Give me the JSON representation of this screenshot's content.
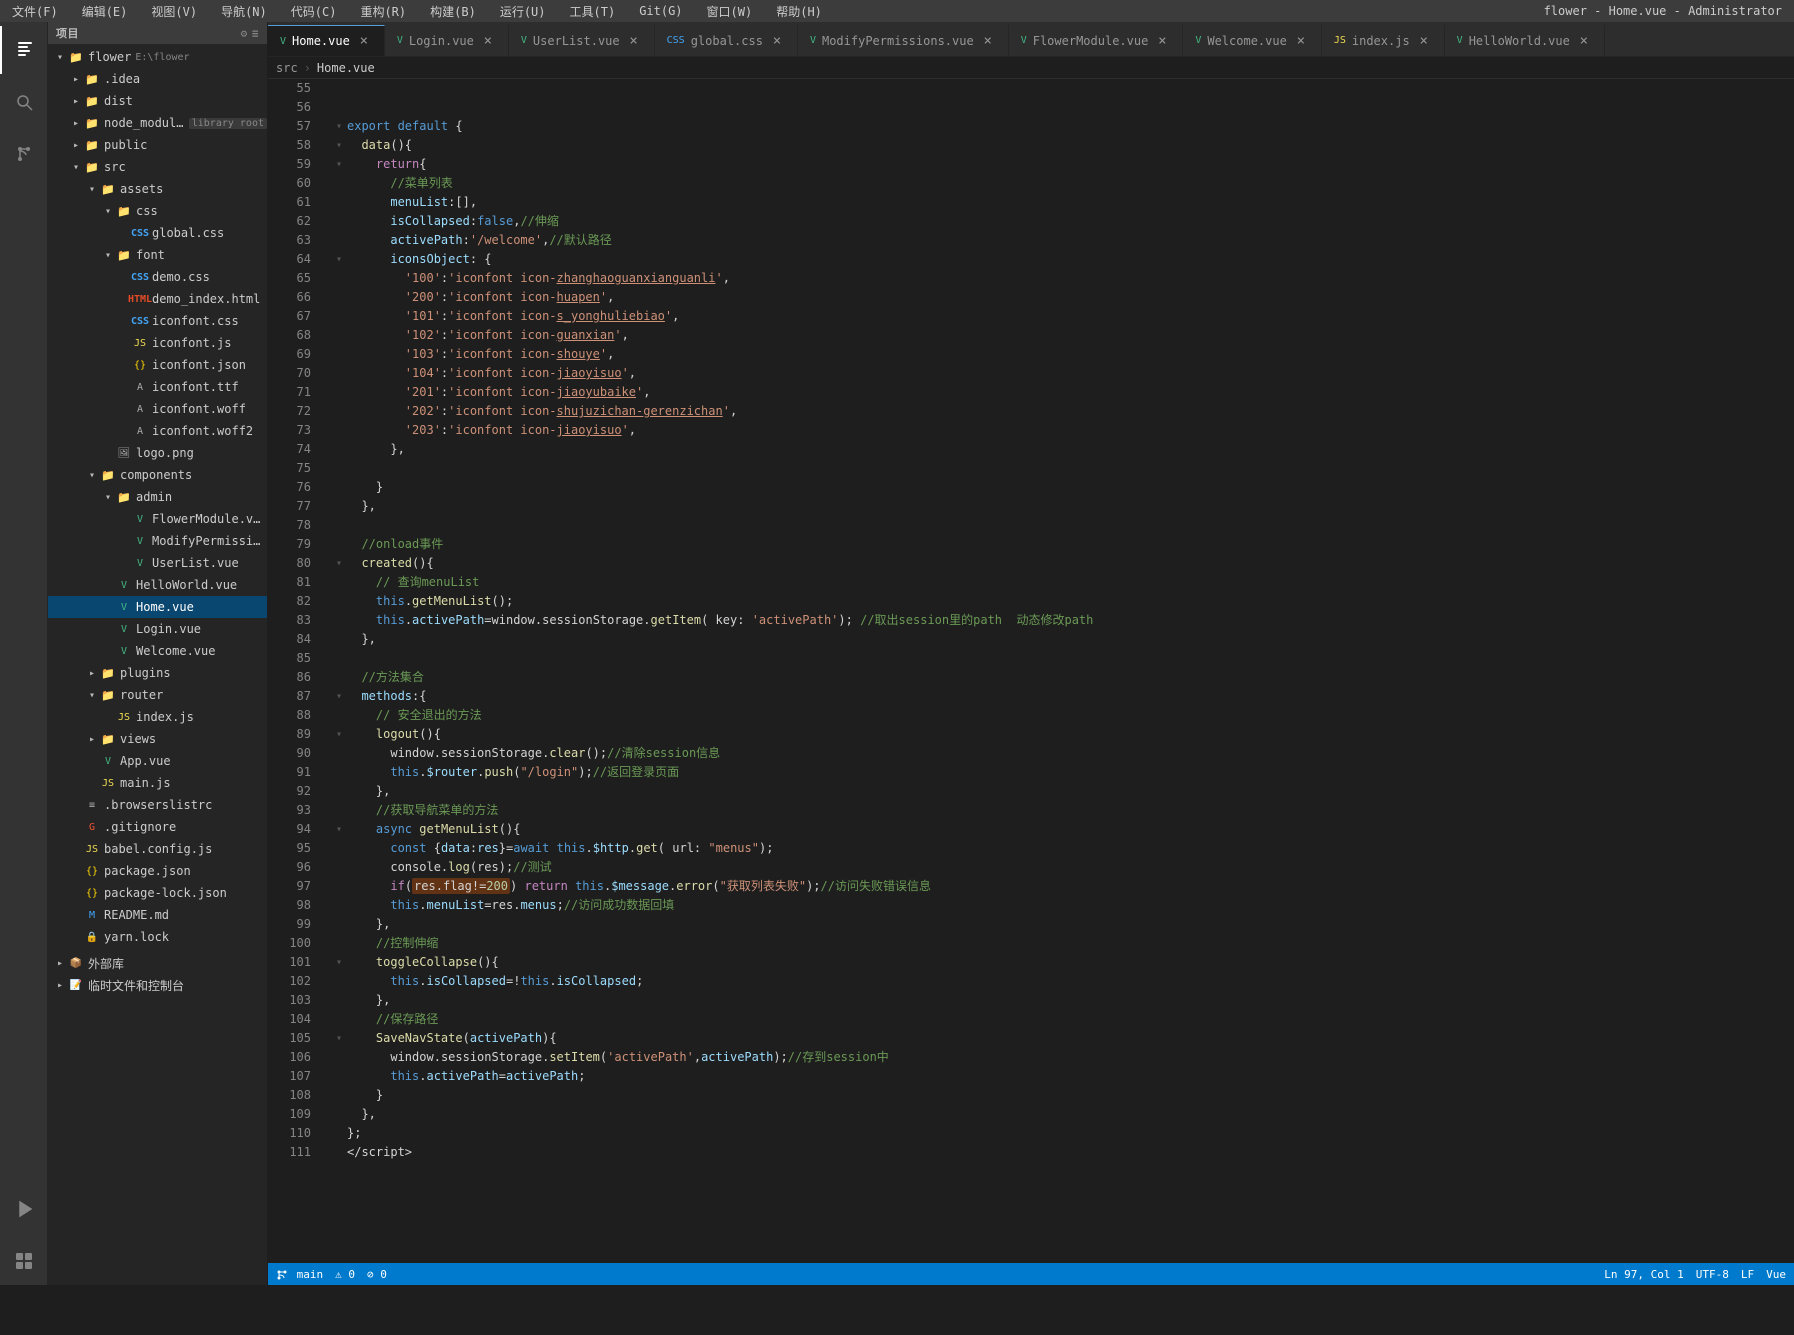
{
  "window": {
    "title": "flower - Home.vue - Administrator"
  },
  "menubar": {
    "items": [
      "文件(F)",
      "编辑(E)",
      "视图(V)",
      "导航(N)",
      "代码(C)",
      "重构(R)",
      "构建(B)",
      "运行(U)",
      "工具(T)",
      "Git(G)",
      "窗口(W)",
      "帮助(H)"
    ]
  },
  "toolbar": {
    "project_label": "项目",
    "icons": [
      "list-icon",
      "align-icon",
      "settings-icon",
      "add-icon"
    ]
  },
  "tabs": [
    {
      "label": "Home.vue",
      "icon": "vue-icon",
      "active": true,
      "dirty": false
    },
    {
      "label": "Login.vue",
      "icon": "vue-icon",
      "active": false
    },
    {
      "label": "UserList.vue",
      "icon": "vue-icon",
      "active": false
    },
    {
      "label": "global.css",
      "icon": "css-icon",
      "active": false
    },
    {
      "label": "ModifyPermissions.vue",
      "icon": "vue-icon",
      "active": false
    },
    {
      "label": "FlowerModule.vue",
      "icon": "vue-icon",
      "active": false
    },
    {
      "label": "Welcome.vue",
      "icon": "vue-icon",
      "active": false
    },
    {
      "label": "index.js",
      "icon": "js-icon",
      "active": false
    },
    {
      "label": "HelloWorld.vue",
      "icon": "vue-icon",
      "active": false
    }
  ],
  "breadcrumb": {
    "parts": [
      "src",
      "▸",
      "Home.vue"
    ]
  },
  "sidebar": {
    "header": "项目",
    "tree": [
      {
        "id": "flower",
        "label": "flower",
        "type": "folder",
        "level": 0,
        "expanded": true
      },
      {
        "id": "idea",
        "label": ".idea",
        "type": "folder",
        "level": 1,
        "expanded": false
      },
      {
        "id": "dist",
        "label": "dist",
        "type": "folder",
        "level": 1,
        "expanded": false
      },
      {
        "id": "node_modules",
        "label": "node_modules",
        "type": "folder-special",
        "level": 1,
        "expanded": false,
        "badge": "library root"
      },
      {
        "id": "public",
        "label": "public",
        "type": "folder",
        "level": 1,
        "expanded": false
      },
      {
        "id": "src",
        "label": "src",
        "type": "folder",
        "level": 1,
        "expanded": true
      },
      {
        "id": "assets",
        "label": "assets",
        "type": "folder",
        "level": 2,
        "expanded": true
      },
      {
        "id": "css",
        "label": "css",
        "type": "folder",
        "level": 3,
        "expanded": true
      },
      {
        "id": "global_css",
        "label": "global.css",
        "type": "css",
        "level": 4
      },
      {
        "id": "font",
        "label": "font",
        "type": "folder",
        "level": 3,
        "expanded": true
      },
      {
        "id": "demo_css",
        "label": "demo.css",
        "type": "css",
        "level": 4
      },
      {
        "id": "demo_html",
        "label": "demo_index.html",
        "type": "html",
        "level": 4
      },
      {
        "id": "iconfont_css",
        "label": "iconfont.css",
        "type": "css",
        "level": 4
      },
      {
        "id": "iconfont_js",
        "label": "iconfont.js",
        "type": "js",
        "level": 4
      },
      {
        "id": "iconfont_json",
        "label": "iconfont.json",
        "type": "json",
        "level": 4
      },
      {
        "id": "iconfont_ttf",
        "label": "iconfont.ttf",
        "type": "font",
        "level": 4
      },
      {
        "id": "iconfont_woff",
        "label": "iconfont.woff",
        "type": "font",
        "level": 4
      },
      {
        "id": "iconfont_woff2",
        "label": "iconfont.woff2",
        "type": "font",
        "level": 4
      },
      {
        "id": "logo_png",
        "label": "logo.png",
        "type": "image",
        "level": 3
      },
      {
        "id": "components",
        "label": "components",
        "type": "folder",
        "level": 2,
        "expanded": true
      },
      {
        "id": "admin",
        "label": "admin",
        "type": "folder",
        "level": 3,
        "expanded": true
      },
      {
        "id": "FlowerModule_vue",
        "label": "FlowerModule.vue",
        "type": "vue",
        "level": 4
      },
      {
        "id": "ModifyPermissions_vue",
        "label": "ModifyPermissions.vue",
        "type": "vue",
        "level": 4
      },
      {
        "id": "UserList_vue",
        "label": "UserList.vue",
        "type": "vue",
        "level": 4
      },
      {
        "id": "HelloWorld_vue",
        "label": "HelloWorld.vue",
        "type": "vue",
        "level": 4
      },
      {
        "id": "Home_vue",
        "label": "Home.vue",
        "type": "vue",
        "level": 3,
        "active": true
      },
      {
        "id": "Login_vue",
        "label": "Login.vue",
        "type": "vue",
        "level": 3
      },
      {
        "id": "Welcome_vue",
        "label": "Welcome.vue",
        "type": "vue",
        "level": 3
      },
      {
        "id": "plugins",
        "label": "plugins",
        "type": "folder",
        "level": 2,
        "expanded": false
      },
      {
        "id": "router",
        "label": "router",
        "type": "folder",
        "level": 2,
        "expanded": true
      },
      {
        "id": "index_js",
        "label": "index.js",
        "type": "js",
        "level": 3
      },
      {
        "id": "views",
        "label": "views",
        "type": "folder",
        "level": 2,
        "expanded": false
      },
      {
        "id": "App_vue",
        "label": "App.vue",
        "type": "vue",
        "level": 2
      },
      {
        "id": "main_js",
        "label": "main.js",
        "type": "js",
        "level": 2
      },
      {
        "id": "browserslistrc",
        "label": ".browserslistrc",
        "type": "txt",
        "level": 1
      },
      {
        "id": "gitignore",
        "label": ".gitignore",
        "type": "txt",
        "level": 1
      },
      {
        "id": "babel_config",
        "label": "babel.config.js",
        "type": "js",
        "level": 1
      },
      {
        "id": "package_json",
        "label": "package.json",
        "type": "json",
        "level": 1
      },
      {
        "id": "package_lock",
        "label": "package-lock.json",
        "type": "json",
        "level": 1
      },
      {
        "id": "readme",
        "label": "README.md",
        "type": "txt",
        "level": 1
      },
      {
        "id": "yarn_lock",
        "label": "yarn.lock",
        "type": "lock",
        "level": 1
      },
      {
        "id": "external_libs",
        "label": "外部库",
        "type": "folder",
        "level": 0,
        "expanded": false
      },
      {
        "id": "scratch",
        "label": "临时文件和控制台",
        "type": "folder",
        "level": 0,
        "expanded": false
      }
    ]
  },
  "editor": {
    "lines": [
      {
        "num": 55,
        "fold": "",
        "content": ""
      },
      {
        "num": 56,
        "fold": "",
        "content": ""
      },
      {
        "num": 57,
        "fold": "▾",
        "content": "<kw>export default</kw> <punc>{</punc>"
      },
      {
        "num": 58,
        "fold": "▾",
        "content": "  <fn>data</fn><punc>(){</punc>"
      },
      {
        "num": 59,
        "fold": "▾",
        "content": "    <kw-flow>return</kw-flow><punc>{</punc>"
      },
      {
        "num": 60,
        "fold": "",
        "content": "      <comment>//菜单列表</comment>"
      },
      {
        "num": 61,
        "fold": "",
        "content": "      <prop>menuList</prop><punc>:[],</punc>"
      },
      {
        "num": 62,
        "fold": "",
        "content": "      <prop>isCollapsed</prop><punc>:</punc><kw>false</kw><punc>,</punc><comment>//伸缩</comment>"
      },
      {
        "num": 63,
        "fold": "",
        "content": "      <prop>activePath</prop><punc>:</punc><str>'/welcome'</str><punc>,</punc><comment>//默认路径</comment>"
      },
      {
        "num": 64,
        "fold": "▾",
        "content": "      <prop>iconsObject</prop><punc>: {</punc>"
      },
      {
        "num": 65,
        "fold": "",
        "content": "        <str>'100'</str><punc>:</punc><str>'iconfont icon-<u>zhanghaoguanxianguanli</u>'</str><punc>,</punc>"
      },
      {
        "num": 66,
        "fold": "",
        "content": "        <str>'200'</str><punc>:</punc><str>'iconfont icon-<u>huapen</u>'</str><punc>,</punc>"
      },
      {
        "num": 67,
        "fold": "",
        "content": "        <str>'101'</str><punc>:</punc><str>'iconfont icon-<u>s_yonghuliebiao</u>'</str><punc>,</punc>"
      },
      {
        "num": 68,
        "fold": "",
        "content": "        <str>'102'</str><punc>:</punc><str>'iconfont icon-<u>guanxian</u>'</str><punc>,</punc>"
      },
      {
        "num": 69,
        "fold": "",
        "content": "        <str>'103'</str><punc>:</punc><str>'iconfont icon-<u>shouye</u>'</str><punc>,</punc>"
      },
      {
        "num": 70,
        "fold": "",
        "content": "        <str>'104'</str><punc>:</punc><str>'iconfont icon-<u>jiaoyisuo</u>'</str><punc>,</punc>"
      },
      {
        "num": 71,
        "fold": "",
        "content": "        <str>'201'</str><punc>:</punc><str>'iconfont icon-<u>jiaoyubaike</u>'</str><punc>,</punc>"
      },
      {
        "num": 72,
        "fold": "",
        "content": "        <str>'202'</str><punc>:</punc><str>'iconfont icon-<u>shujuzichan-gerenzichan</u>'</str><punc>,</punc>"
      },
      {
        "num": 73,
        "fold": "",
        "content": "        <str>'203'</str><punc>:</punc><str>'iconfont icon-<u>jiaoyisuo</u>'</str><punc>,</punc>"
      },
      {
        "num": 74,
        "fold": "",
        "content": "      <punc>},</punc>"
      },
      {
        "num": 75,
        "fold": "",
        "content": ""
      },
      {
        "num": 76,
        "fold": "",
        "content": "    <punc>}</punc>"
      },
      {
        "num": 77,
        "fold": "",
        "content": "  <punc>},</punc>"
      },
      {
        "num": 78,
        "fold": "",
        "content": ""
      },
      {
        "num": 79,
        "fold": "",
        "content": "  <comment>//onload事件</comment>"
      },
      {
        "num": 80,
        "fold": "▾",
        "content": "  <fn>created</fn><punc>(){</punc>"
      },
      {
        "num": 81,
        "fold": "",
        "content": "    <comment>// 查询menuList</comment>"
      },
      {
        "num": 82,
        "fold": "",
        "content": "    <this-kw>this</this-kw><punc>.</punc><fn>getMenuList</fn><punc>();</punc>"
      },
      {
        "num": 83,
        "fold": "",
        "content": "    <this-kw>this</this-kw><punc>.</punc><prop>activePath</prop><punc>=</punc>window<punc>.</punc>sessionStorage<punc>.</punc><fn>getItem</fn><punc>(</punc> key<punc>:</punc> <str>'activePath'</str><punc>);</punc> <comment>//取出session里的path  动态修改path</comment>"
      },
      {
        "num": 84,
        "fold": "",
        "content": "  <punc>},</punc>"
      },
      {
        "num": 85,
        "fold": "",
        "content": ""
      },
      {
        "num": 86,
        "fold": "",
        "content": "  <comment>//方法集合</comment>"
      },
      {
        "num": 87,
        "fold": "▾",
        "content": "  <prop>methods</prop><punc>:{</punc>"
      },
      {
        "num": 88,
        "fold": "",
        "content": "    <comment>// 安全退出的方法</comment>"
      },
      {
        "num": 89,
        "fold": "▾",
        "content": "    <fn>logout</fn><punc>(){</punc>"
      },
      {
        "num": 90,
        "fold": "",
        "content": "      window<punc>.</punc>sessionStorage<punc>.</punc><fn>clear</fn><punc>();</punc><comment>//清除session信息</comment>"
      },
      {
        "num": 91,
        "fold": "",
        "content": "      <this-kw>this</this-kw><punc>.</punc><prop>$router</prop><punc>.</punc><fn>push</fn><punc>(</punc><str>\"/login\"</str><punc>);</punc><comment>//返回登录页面</comment>"
      },
      {
        "num": 92,
        "fold": "",
        "content": "    <punc>},</punc>"
      },
      {
        "num": 93,
        "fold": "",
        "content": "    <comment>//获取导航菜单的方法</comment>"
      },
      {
        "num": 94,
        "fold": "▾",
        "content": "    <kw>async</kw> <fn>getMenuList</fn><punc>(){</punc>"
      },
      {
        "num": 95,
        "fold": "",
        "content": "      <kw>const</kw> <punc>{</punc><prop>data</prop><punc>:</punc><prop>res</prop><punc>}=</punc><kw>await</kw> <this-kw>this</this-kw><punc>.</punc><prop>$http</prop><punc>.</punc><fn>get</fn><punc>(</punc> url<punc>:</punc> <str>\"menus\"</str><punc>);</punc>"
      },
      {
        "num": 96,
        "fold": "",
        "content": "      console<punc>.</punc><fn>log</fn><punc>(</punc>res<punc>);</punc><comment>//测试</comment>"
      },
      {
        "num": 97,
        "fold": "",
        "content": "      <kw-flow>if</kw-flow><punc>(</punc><span class=\"highlight-bg\">res<punc>.</punc>flag<punc>!=</punc><num>200</num></span><punc>)</punc> <kw-flow>return</kw-flow> <this-kw>this</this-kw><punc>.</punc><prop>$message</prop><punc>.</punc><fn>error</fn><punc>(</punc><str>\"获取列表失败\"</str><punc>);</punc><comment>//访问失败错误信息</comment>"
      },
      {
        "num": 98,
        "fold": "",
        "content": "      <this-kw>this</this-kw><punc>.</punc><prop>menuList</prop><punc>=</punc>res<punc>.</punc><prop>menus</prop><punc>;</punc><comment>//访问成功数据回填</comment>"
      },
      {
        "num": 99,
        "fold": "",
        "content": "    <punc>},</punc>"
      },
      {
        "num": 100,
        "fold": "",
        "content": "    <comment>//控制伸缩</comment>"
      },
      {
        "num": 101,
        "fold": "▾",
        "content": "    <fn>toggleCollapse</fn><punc>(){</punc>"
      },
      {
        "num": 102,
        "fold": "",
        "content": "      <this-kw>this</this-kw><punc>.</punc><prop>isCollapsed</prop><punc>=!</punc><this-kw>this</this-kw><punc>.</punc><prop>isCollapsed</prop><punc>;</punc>"
      },
      {
        "num": 103,
        "fold": "",
        "content": "    <punc>},</punc>"
      },
      {
        "num": 104,
        "fold": "",
        "content": "    <comment>//保存路径</comment>"
      },
      {
        "num": 105,
        "fold": "▾",
        "content": "    <fn>SaveNavState</fn><punc>(</punc><prop>activePath</prop><punc>){</punc>"
      },
      {
        "num": 106,
        "fold": "",
        "content": "      window<punc>.</punc>sessionStorage<punc>.</punc><fn>setItem</fn><punc>(</punc><str>'activePath'</str><punc>,</punc><prop>activePath</prop><punc>);</punc><comment>//存到session中</comment>"
      },
      {
        "num": 107,
        "fold": "",
        "content": "      <this-kw>this</this-kw><punc>.</punc><prop>activePath</prop><punc>=</punc><prop>activePath</prop><punc>;</punc>"
      },
      {
        "num": 108,
        "fold": "",
        "content": "    <punc>}</punc>"
      },
      {
        "num": 109,
        "fold": "",
        "content": "  <punc>},</punc>"
      },
      {
        "num": 110,
        "fold": "",
        "content": "<punc>};</punc>"
      },
      {
        "num": 111,
        "fold": "",
        "content": "<punc>&lt;/script&gt;</punc>"
      }
    ]
  },
  "status_bar": {
    "branch": "Git: main",
    "errors": "0 errors",
    "warnings": "0 warnings",
    "encoding": "UTF-8",
    "line_ending": "LF",
    "file_type": "Vue",
    "position": "Ln 97, Col 1"
  }
}
